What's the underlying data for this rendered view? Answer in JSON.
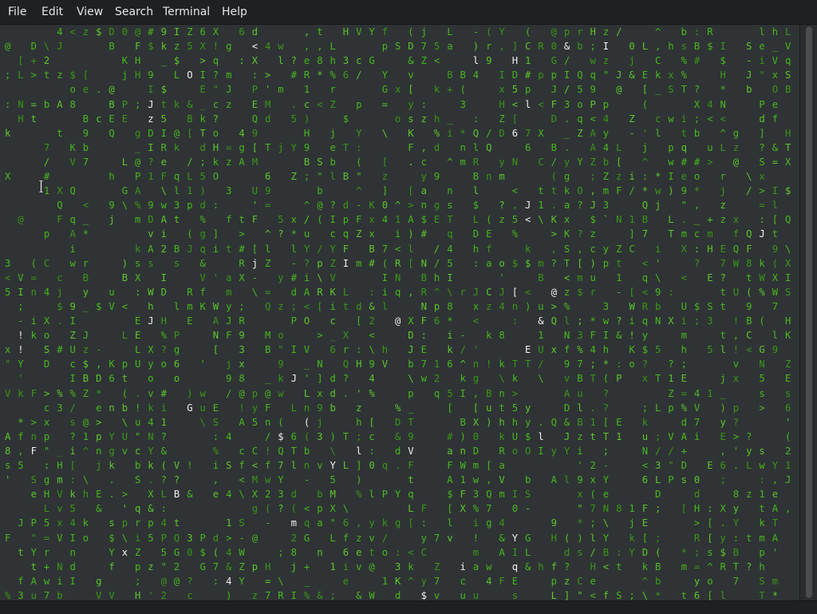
{
  "menubar": {
    "items": [
      {
        "name": "menu-file",
        "label": "File"
      },
      {
        "name": "menu-edit",
        "label": "Edit"
      },
      {
        "name": "menu-view",
        "label": "View"
      },
      {
        "name": "menu-search",
        "label": "Search"
      },
      {
        "name": "menu-terminal",
        "label": "Terminal"
      },
      {
        "name": "menu-help",
        "label": "Help"
      }
    ]
  },
  "terminal": {
    "rain_columns": [
      "W;]C)x",
      "JqsKSn6URIT865&fNA9p6",
      "V9&mK",
      "yp6bwK",
      "2\\S-fA",
      "-_f=zx",
      "qre",
      "&2r9",
      "&F",
      "M",
      "VIkK=Q#pdq",
      "gN@",
      "p=;bg#",
      "kB^(",
      "?5,B",
      "6",
      "7Y[",
      "m",
      "Dy",
      "dF",
      "i"
    ],
    "white_glyphs": [
      "&",
      "q",
      "x",
      "Y",
      "[",
      "E",
      ")",
      "[",
      "<",
      "?",
      "H",
      "z",
      "P",
      "m",
      "3",
      "6",
      "$",
      "O",
      "h",
      "4",
      "Y",
      "D",
      "s",
      "3",
      "6",
      "D",
      "z",
      "4",
      "l",
      "i",
      "F",
      "j",
      "V",
      "a",
      "i",
      "l",
      "J",
      "I",
      "<",
      "(",
      "&",
      "[",
      "@",
      "*",
      "6",
      "!",
      "I",
      "J",
      "B",
      "G"
    ],
    "fg_color": "#48b81f",
    "bg_color": "#2f3335"
  }
}
